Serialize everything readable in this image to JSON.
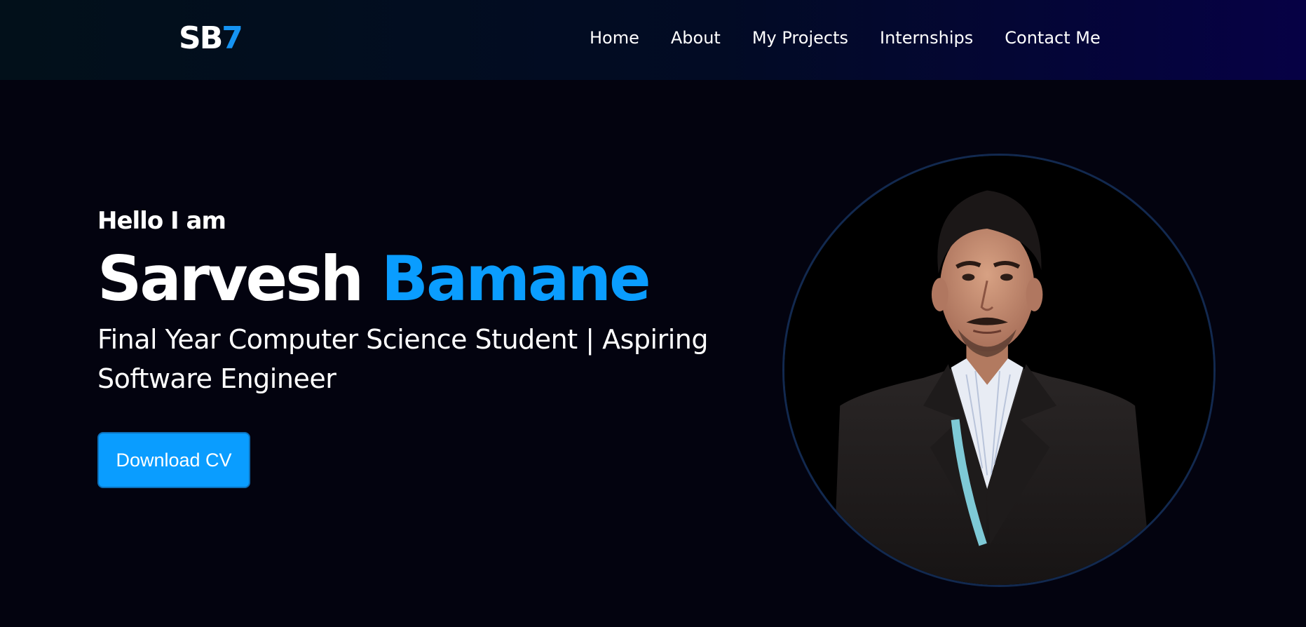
{
  "header": {
    "logo_main": "SB",
    "logo_accent": "7",
    "nav": [
      {
        "label": "Home"
      },
      {
        "label": "About"
      },
      {
        "label": "My Projects"
      },
      {
        "label": "Internships"
      },
      {
        "label": "Contact Me"
      }
    ]
  },
  "hero": {
    "greeting": "Hello I am",
    "first_name": "Sarvesh",
    "last_name": "Bamane",
    "tagline": "Final Year Computer Science Student | Aspiring Software Engineer",
    "cv_button_label": "Download CV"
  },
  "profile_photo": {
    "icon": "profile-photo"
  },
  "colors": {
    "background": "#03030f",
    "accent": "#0a9dff",
    "logo_accent": "#1593f2",
    "nav_gradient_start": "#02101a",
    "nav_gradient_end": "#060145"
  }
}
